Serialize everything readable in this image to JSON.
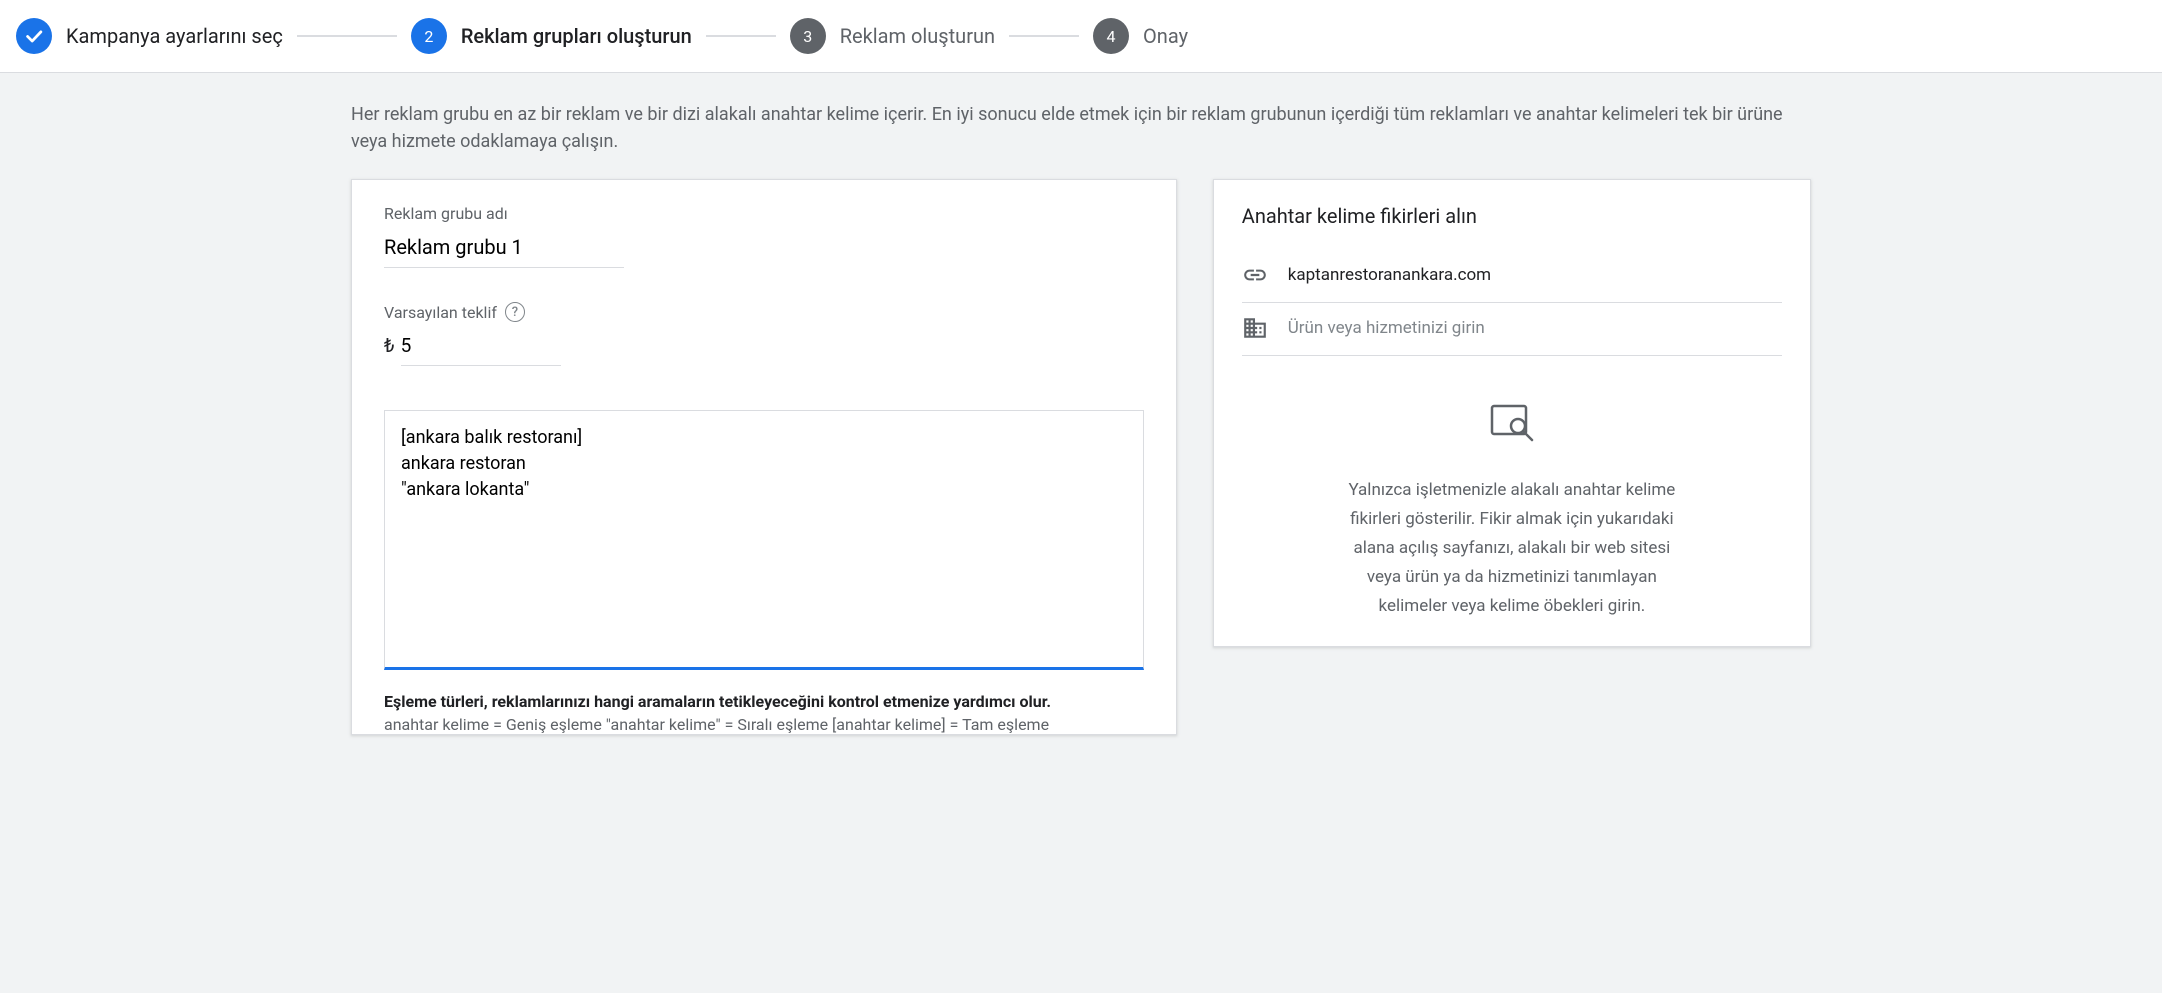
{
  "stepper": {
    "step1": "Kampanya ayarlarını seç",
    "step2_num": "2",
    "step2": "Reklam grupları oluşturun",
    "step3_num": "3",
    "step3": "Reklam oluşturun",
    "step4_num": "4",
    "step4": "Onay"
  },
  "intro": "Her reklam grubu en az bir reklam ve bir dizi alakalı anahtar kelime içerir. En iyi sonucu elde etmek için bir reklam grubunun içerdiği tüm reklamları ve anahtar kelimeleri tek bir ürüne veya hizmete odaklamaya çalışın.",
  "adgroup": {
    "name_label": "Reklam grubu adı",
    "name_value": "Reklam grubu 1",
    "bid_label": "Varsayılan teklif",
    "bid_currency": "₺",
    "bid_value": "5",
    "keywords_value": "[ankara balık restoranı]\nankara restoran\n\"ankara lokanta\"",
    "hint_title": "Eşleme türleri, reklamlarınızı hangi aramaların tetikleyeceğini kontrol etmenize yardımcı olur.",
    "hint_line": "anahtar kelime = Geniş eşleme   \"anahtar kelime\" = Sıralı eşleme   [anahtar kelime] = Tam eşleme"
  },
  "ideas": {
    "title": "Anahtar kelime fikirleri alın",
    "url_value": "kaptanrestoranankara.com",
    "product_placeholder": "Ürün veya hizmetinizi girin",
    "empty_text": "Yalnızca işletmenizle alakalı anahtar kelime fikirleri gösterilir. Fikir almak için yukarıdaki alana açılış sayfanızı, alakalı bir web sitesi veya ürün ya da hizmetinizi tanımlayan kelimeler veya kelime öbekleri girin."
  }
}
